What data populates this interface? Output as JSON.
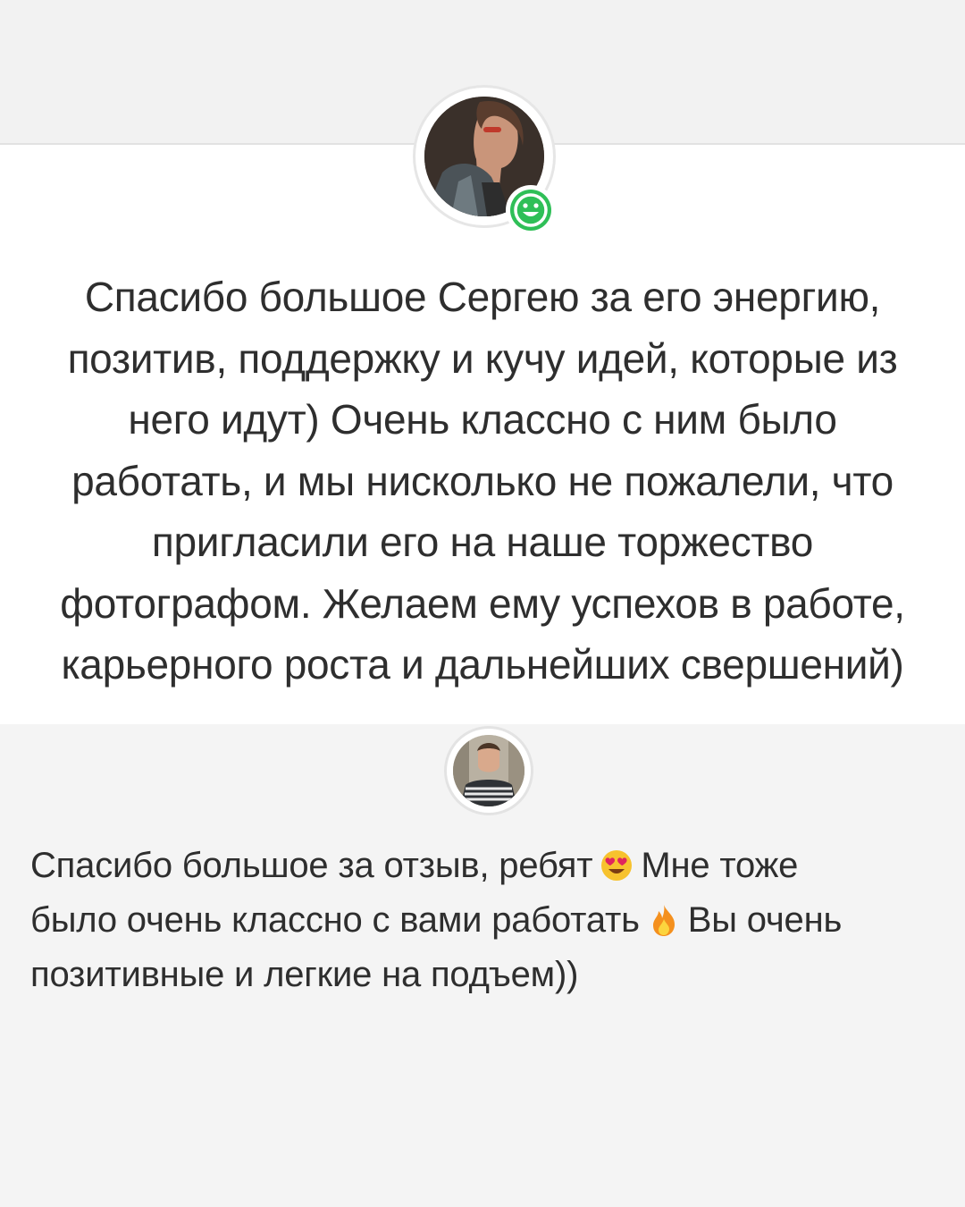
{
  "review": {
    "lines": [
      "Спасибо большое Сергею за его энергию,",
      "позитив, поддержку и кучу идей, которые из",
      "него идут) Очень классно с ним было",
      "работать, и мы нисколько не пожалели, что",
      "пригласили его на наше торжество",
      "фотографом. Желаем ему успехов в работе,",
      "карьерного роста и дальнейших свершений)"
    ]
  },
  "reply": {
    "line1_start": "Спасибо большое за отзыв, ребят",
    "line1_emoji": "heart-eyes-emoji",
    "line1_end": "Мне тоже",
    "line2_start": "было очень классно с вами работать",
    "line2_emoji": "fire-emoji",
    "line2_end": "Вы очень",
    "line3": "позитивные и легкие на подъем))"
  },
  "badge": {
    "icon": "smiley-icon",
    "color": "#2fbf57"
  }
}
